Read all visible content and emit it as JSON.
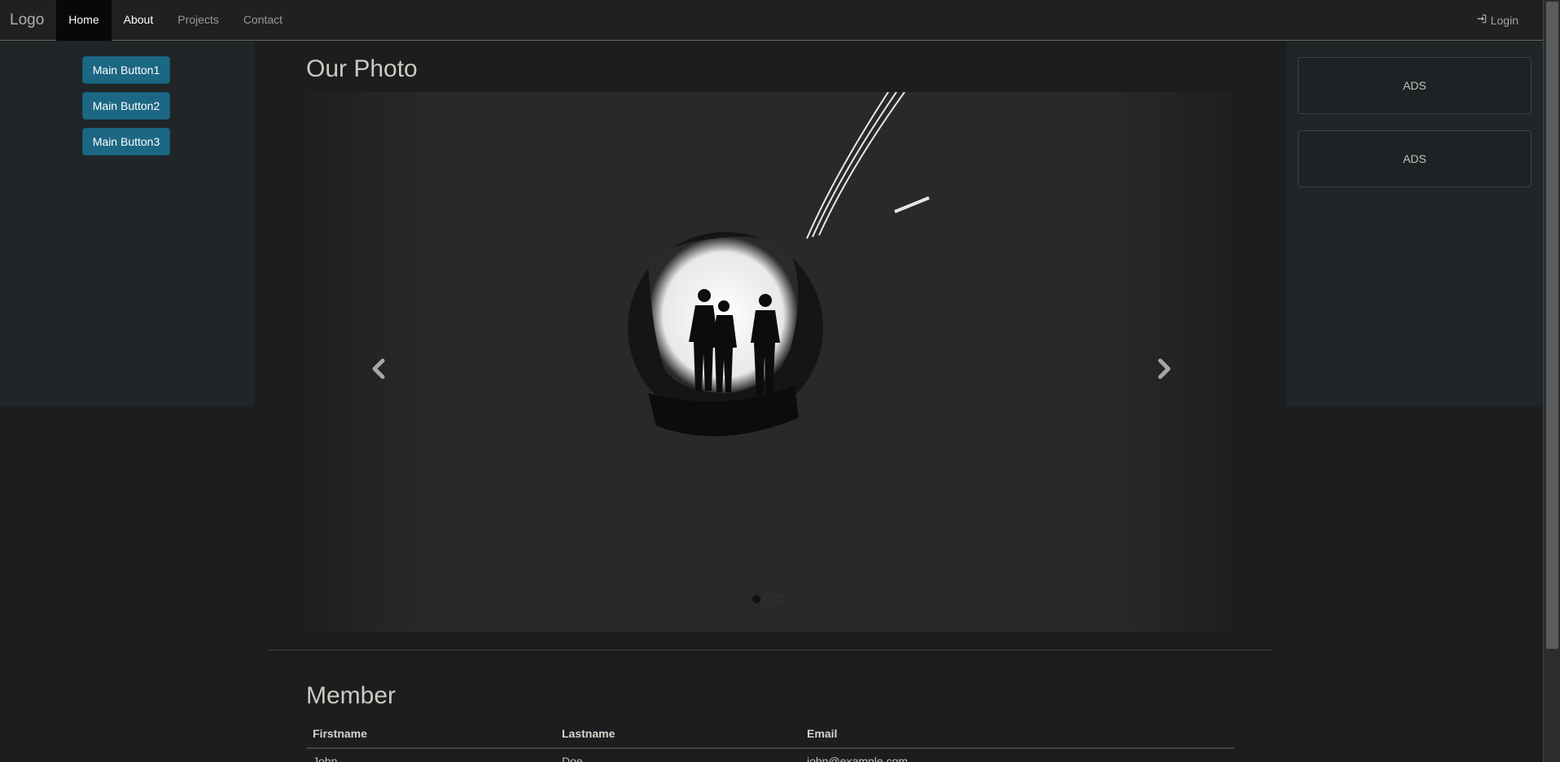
{
  "navbar": {
    "logo": "Logo",
    "items": [
      {
        "label": "Home",
        "active": true
      },
      {
        "label": "About",
        "active": false
      },
      {
        "label": "Projects",
        "active": false
      },
      {
        "label": "Contact",
        "active": false
      }
    ],
    "login_label": "Login"
  },
  "sidebar_left": {
    "buttons": [
      "Main Button1",
      "Main Button2",
      "Main Button3"
    ]
  },
  "sidebar_right": {
    "ads": [
      "ADS",
      "ADS"
    ]
  },
  "main": {
    "photo_title": "Our Photo",
    "carousel": {
      "slide_count": 3,
      "active_index": 0
    },
    "member_title": "Member",
    "table": {
      "headers": [
        "Firstname",
        "Lastname",
        "Email"
      ],
      "rows": [
        [
          "John",
          "Doe",
          "john@example.com"
        ]
      ]
    }
  },
  "colors": {
    "primary_button": "#1c6783",
    "navbar_bg": "#1e2022",
    "active_nav_bg": "#070808",
    "sidebar_bg": "#202527",
    "page_bg": "#1b1d1f"
  }
}
